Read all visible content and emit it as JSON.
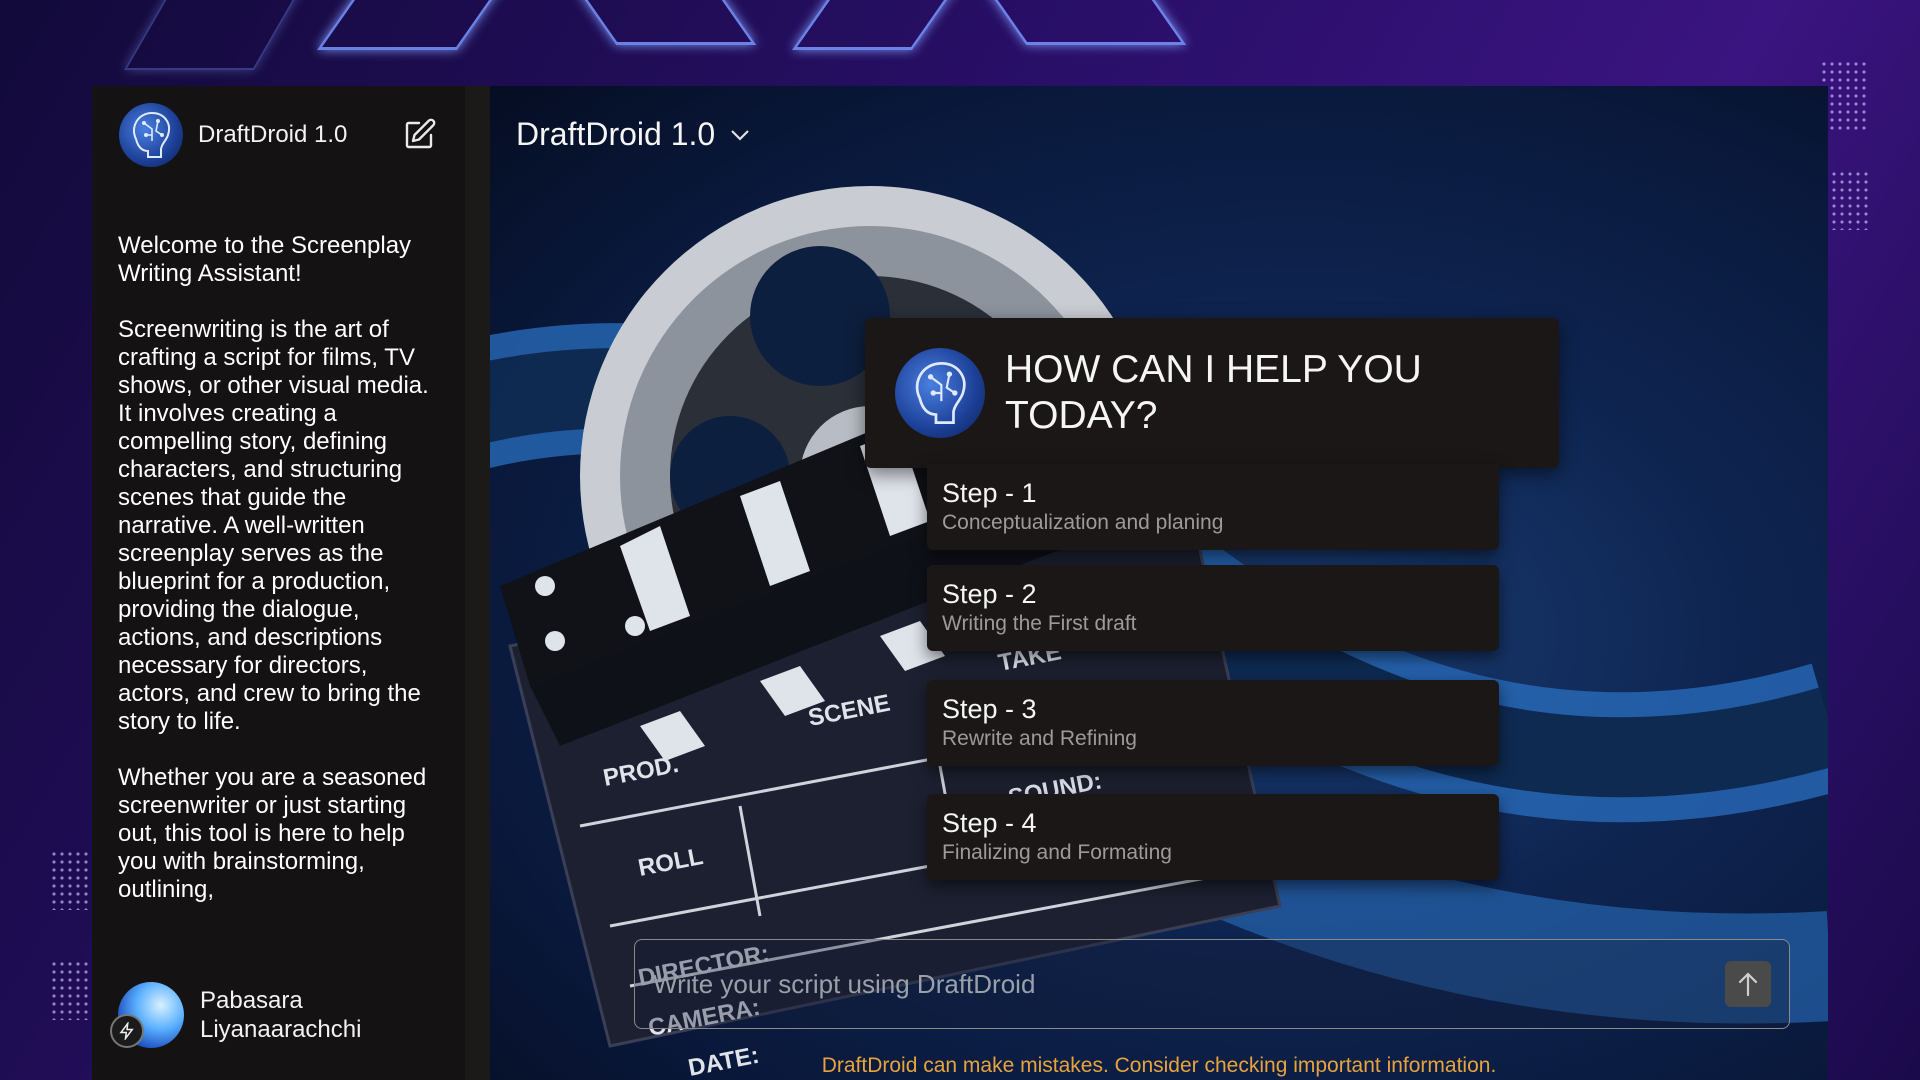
{
  "app": {
    "name": "DraftDroid 1.0"
  },
  "sidebar": {
    "title": "DraftDroid 1.0",
    "intro_paragraphs": [
      "Welcome to the Screenplay Writing Assistant!",
      "Screenwriting is the art of crafting a script for films, TV shows, or other visual media. It involves creating a compelling story, defining characters, and structuring scenes that guide the narrative. A well-written screenplay serves as the blueprint for a production, providing the dialogue, actions, and descriptions necessary for directors, actors, and crew to bring the story to life.",
      "Whether you are a seasoned screenwriter or just starting out, this tool is here to help you with brainstorming, outlining,"
    ],
    "user": {
      "name": "Pabasara Liyanaarachchi"
    }
  },
  "main": {
    "model_selector": "DraftDroid 1.0",
    "hero_labels": [
      "PROD.",
      "SCENE",
      "TAKE",
      "ROLL",
      "SOUND:",
      "DIRECTOR:",
      "CAMERA:",
      "DATE:"
    ],
    "help_title": "HOW CAN I HELP YOU TODAY?",
    "steps": [
      {
        "title": "Step - 1",
        "subtitle": "Conceptualization and planing"
      },
      {
        "title": "Step - 2",
        "subtitle": "Writing the First draft"
      },
      {
        "title": "Step - 3",
        "subtitle": "Rewrite and Refining"
      },
      {
        "title": "Step - 4",
        "subtitle": "Finalizing and Formating"
      }
    ],
    "composer": {
      "placeholder": "Write your script using DraftDroid"
    },
    "disclaimer": "DraftDroid can make mistakes. Consider checking important information."
  },
  "icons": {
    "logo": "brain-circuit-icon",
    "edit": "edit-icon",
    "model_dropdown": "chevron-down-icon",
    "send": "arrow-up-icon",
    "user_badge": "lightning-icon"
  },
  "colors": {
    "sidebar_bg": "#141212",
    "card_bg": "#1b1716",
    "disclaimer": "#e7a43b",
    "step_subtitle": "#9d9a98"
  }
}
